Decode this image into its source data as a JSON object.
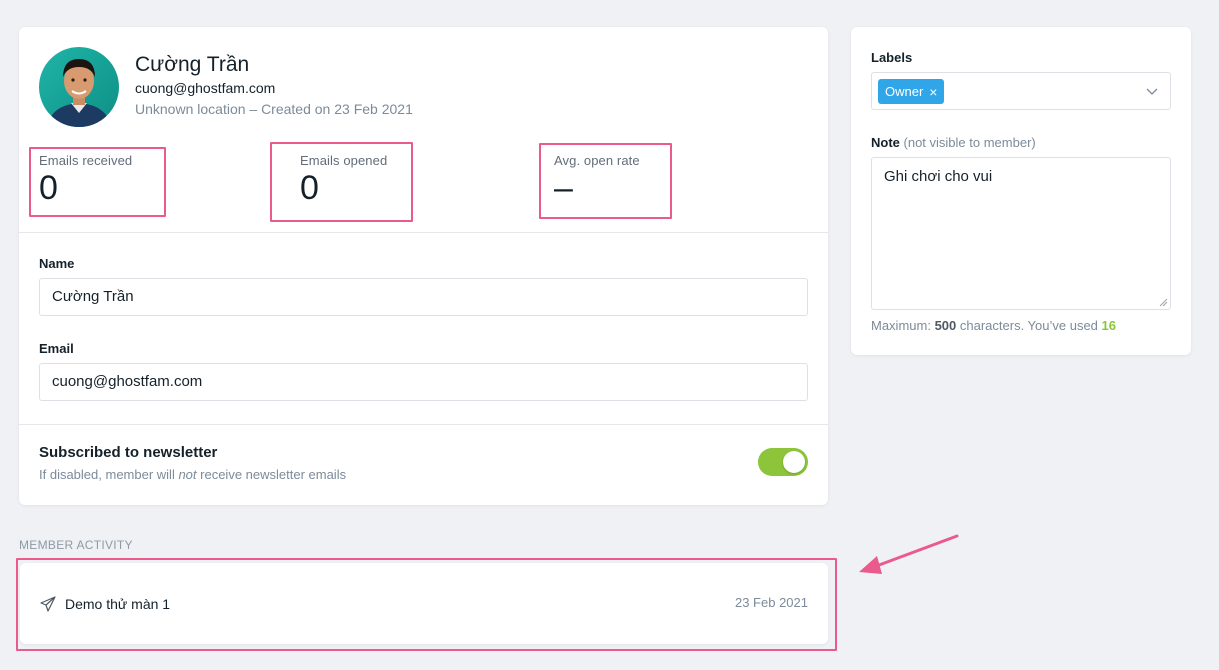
{
  "member": {
    "name": "Cường Trần",
    "email": "cuong@ghostfam.com",
    "meta": "Unknown location – Created on 23 Feb 2021"
  },
  "stats": [
    {
      "label": "Emails received",
      "value": "0"
    },
    {
      "label": "Emails opened",
      "value": "0"
    },
    {
      "label": "Avg. open rate",
      "value": "–"
    }
  ],
  "form": {
    "name_label": "Name",
    "name_value": "Cường Trần",
    "email_label": "Email",
    "email_value": "cuong@ghostfam.com"
  },
  "newsletter": {
    "title": "Subscribed to newsletter",
    "hint_before": "If disabled, member will ",
    "hint_em": "not",
    "hint_after": " receive newsletter emails",
    "enabled": true
  },
  "sidebar": {
    "labels_label": "Labels",
    "tags": [
      "Owner"
    ],
    "note_label": "Note",
    "note_hint": "(not visible to member)",
    "note_value": "Ghi chơi cho vui",
    "count_prefix": "Maximum: ",
    "count_max": "500",
    "count_middle": " characters. You’ve used ",
    "count_used": "16"
  },
  "activity": {
    "heading": "Member activity",
    "items": [
      {
        "title": "Demo thử màn 1",
        "date": "23 Feb 2021",
        "icon": "send-icon"
      }
    ]
  },
  "colors": {
    "accent_green": "#8cc43a",
    "tag_blue": "#30a6e8",
    "annotation_pink": "#ea5a8b"
  }
}
